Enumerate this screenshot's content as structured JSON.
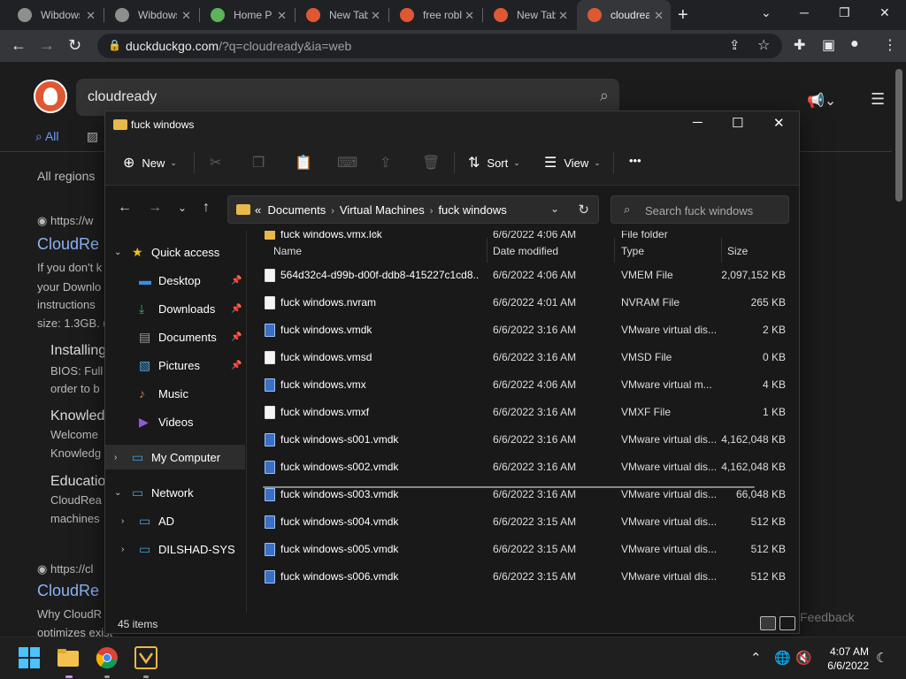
{
  "browser": {
    "tabs": [
      {
        "title": "Wibdows",
        "favicon_color": "#8e8e8e"
      },
      {
        "title": "Wibdows",
        "favicon_color": "#8e8e8e"
      },
      {
        "title": "Home Page",
        "favicon_color": "#5fb35a"
      },
      {
        "title": "New Tab",
        "favicon_color": "#de5833"
      },
      {
        "title": "free roblox",
        "favicon_color": "#de5833"
      },
      {
        "title": "New Tab",
        "favicon_color": "#de5833"
      },
      {
        "title": "cloudready",
        "favicon_color": "#de5833"
      }
    ],
    "new_tab_label": "+",
    "url_host": "duckduckgo.com",
    "url_rest": "/?q=cloudready&ia=web"
  },
  "webpage": {
    "search_query": "cloudready",
    "tab_all": "All",
    "regions": "All regions",
    "result1_url": "https://w",
    "result1_title": "CloudRe",
    "result1_snippet": [
      "If you don't k",
      "your Downlo",
      "instructions",
      "size: 1.3GB. ("
    ],
    "sub1_title": "Installing",
    "sub1_text": [
      "BIOS: Full",
      "order to b"
    ],
    "sub2_title": "Knowled",
    "sub2_text": [
      "Welcome",
      "Knowledg"
    ],
    "sub3_title": "Educatio",
    "sub3_text": [
      "CloudRea",
      "machines"
    ],
    "result2_url": "https://cl",
    "result2_title": "CloudRe",
    "result2_snippet": [
      "Why CloudR",
      "optimizes exist"
    ],
    "feedback": "are Feedback"
  },
  "explorer": {
    "window_title": "fuck windows",
    "commands": {
      "new": "New",
      "sort": "Sort",
      "view": "View",
      "more": "•••"
    },
    "breadcrumb": [
      "Documents",
      "Virtual Machines",
      "fuck windows"
    ],
    "breadcrumb_prefix": "«",
    "search_placeholder": "Search fuck windows",
    "sidebar": [
      {
        "label": "Quick access",
        "icon": "star-icon",
        "color": "#f0c419",
        "level": 0,
        "twisty": "v",
        "pin": false
      },
      {
        "label": "Desktop",
        "icon": "desktop-icon",
        "color": "#3a8ee6",
        "level": 1,
        "twisty": "",
        "pin": true
      },
      {
        "label": "Downloads",
        "icon": "download-icon",
        "color": "#2fb36b",
        "level": 1,
        "twisty": "",
        "pin": true
      },
      {
        "label": "Documents",
        "icon": "document-icon",
        "color": "#9a9a9a",
        "level": 1,
        "twisty": "",
        "pin": true
      },
      {
        "label": "Pictures",
        "icon": "picture-icon",
        "color": "#4aa3df",
        "level": 1,
        "twisty": "",
        "pin": true
      },
      {
        "label": "Music",
        "icon": "music-icon",
        "color": "#e0734a",
        "level": 1,
        "twisty": "",
        "pin": false
      },
      {
        "label": "Videos",
        "icon": "video-icon",
        "color": "#8e5ad8",
        "level": 1,
        "twisty": "",
        "pin": false
      },
      {
        "label": "My Computer",
        "icon": "computer-icon",
        "color": "#4aa3df",
        "level": 0,
        "twisty": ">",
        "pin": false
      },
      {
        "label": "Network",
        "icon": "network-icon",
        "color": "#4aa3df",
        "level": 0,
        "twisty": "v",
        "pin": false
      },
      {
        "label": "AD",
        "icon": "computer-icon",
        "color": "#4aa3df",
        "level": 1,
        "twisty": ">",
        "pin": false
      },
      {
        "label": "DILSHAD-SYS",
        "icon": "computer-icon",
        "color": "#4aa3df",
        "level": 1,
        "twisty": ">",
        "pin": false
      }
    ],
    "columns": [
      "Name",
      "Date modified",
      "Type",
      "Size"
    ],
    "files": [
      {
        "name": "fuck windows.vmx.lck",
        "date": "6/6/2022 4:06 AM",
        "type": "File folder",
        "size": "",
        "kind": "folder"
      },
      {
        "name": "564d32c4-d99b-d00f-ddb8-415227c1cd8...",
        "date": "6/6/2022 4:06 AM",
        "type": "VMEM File",
        "size": "2,097,152 KB",
        "kind": "file"
      },
      {
        "name": "fuck windows.nvram",
        "date": "6/6/2022 4:01 AM",
        "type": "NVRAM File",
        "size": "265 KB",
        "kind": "file"
      },
      {
        "name": "fuck windows.vmdk",
        "date": "6/6/2022 3:16 AM",
        "type": "VMware virtual dis...",
        "size": "2 KB",
        "kind": "vm"
      },
      {
        "name": "fuck windows.vmsd",
        "date": "6/6/2022 3:16 AM",
        "type": "VMSD File",
        "size": "0 KB",
        "kind": "file"
      },
      {
        "name": "fuck windows.vmx",
        "date": "6/6/2022 4:06 AM",
        "type": "VMware virtual m...",
        "size": "4 KB",
        "kind": "vm"
      },
      {
        "name": "fuck windows.vmxf",
        "date": "6/6/2022 3:16 AM",
        "type": "VMXF File",
        "size": "1 KB",
        "kind": "file"
      },
      {
        "name": "fuck windows-s001.vmdk",
        "date": "6/6/2022 3:16 AM",
        "type": "VMware virtual dis...",
        "size": "4,162,048 KB",
        "kind": "vm"
      },
      {
        "name": "fuck windows-s002.vmdk",
        "date": "6/6/2022 3:16 AM",
        "type": "VMware virtual dis...",
        "size": "4,162,048 KB",
        "kind": "vm"
      },
      {
        "name": "fuck windows-s003.vmdk",
        "date": "6/6/2022 3:16 AM",
        "type": "VMware virtual dis...",
        "size": "66,048 KB",
        "kind": "vm"
      },
      {
        "name": "fuck windows-s004.vmdk",
        "date": "6/6/2022 3:15 AM",
        "type": "VMware virtual dis...",
        "size": "512 KB",
        "kind": "vm"
      },
      {
        "name": "fuck windows-s005.vmdk",
        "date": "6/6/2022 3:15 AM",
        "type": "VMware virtual dis...",
        "size": "512 KB",
        "kind": "vm"
      },
      {
        "name": "fuck windows-s006.vmdk",
        "date": "6/6/2022 3:15 AM",
        "type": "VMware virtual dis...",
        "size": "512 KB",
        "kind": "vm"
      }
    ],
    "status_count": "45 items"
  },
  "taskbar": {
    "time": "4:07 AM",
    "date": "6/6/2022"
  }
}
